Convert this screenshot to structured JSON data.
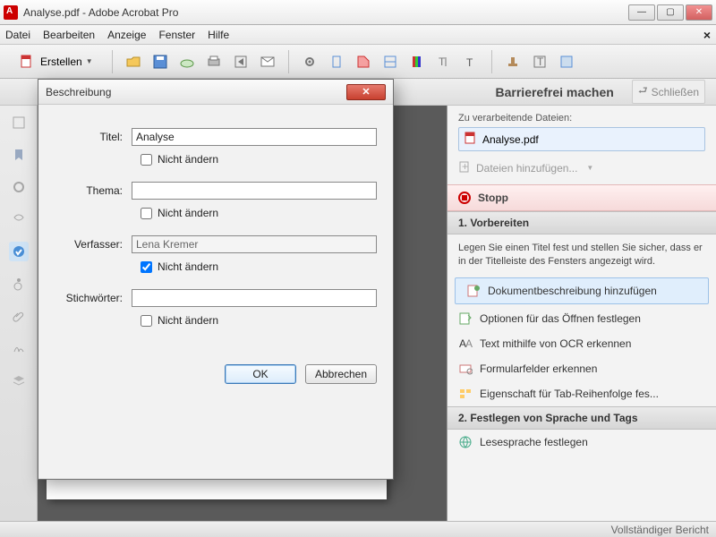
{
  "window": {
    "title": "Analyse.pdf - Adobe Acrobat Pro"
  },
  "menu": {
    "items": [
      "Datei",
      "Bearbeiten",
      "Anzeige",
      "Fenster",
      "Hilfe"
    ]
  },
  "toolbar": {
    "create_label": "Erstellen"
  },
  "panel": {
    "title": "Barrierefrei machen",
    "close_label": "Schließen",
    "files_caption": "Zu verarbeitende Dateien:",
    "file_name": "Analyse.pdf",
    "add_files_label": "Dateien hinzufügen...",
    "stop_label": "Stopp",
    "step1_title": "1. Vorbereiten",
    "step1_text": "Legen Sie einen Titel fest und stellen Sie sicher, dass er in der Titelleiste des Fensters angezeigt wird.",
    "items": [
      "Dokumentbeschreibung hinzufügen",
      "Optionen für das Öffnen festlegen",
      "Text mithilfe von OCR erkennen",
      "Formularfelder erkennen",
      "Eigenschaft für Tab-Reihenfolge fes..."
    ],
    "step2_title": "2. Festlegen von Sprache und Tags",
    "step2_item": "Lesesprache festlegen"
  },
  "statusbar": {
    "text": "Vollständiger Bericht"
  },
  "dialog": {
    "title": "Beschreibung",
    "labels": {
      "titel": "Titel:",
      "thema": "Thema:",
      "verfasser": "Verfasser:",
      "stichworter": "Stichwörter:",
      "nicht_aendern": "Nicht ändern"
    },
    "values": {
      "titel": "Analyse",
      "thema": "",
      "verfasser": "Lena Kremer",
      "stichworter": ""
    },
    "checks": {
      "titel": false,
      "thema": false,
      "verfasser": true,
      "stichworter": false
    },
    "buttons": {
      "ok": "OK",
      "cancel": "Abbrechen"
    }
  }
}
